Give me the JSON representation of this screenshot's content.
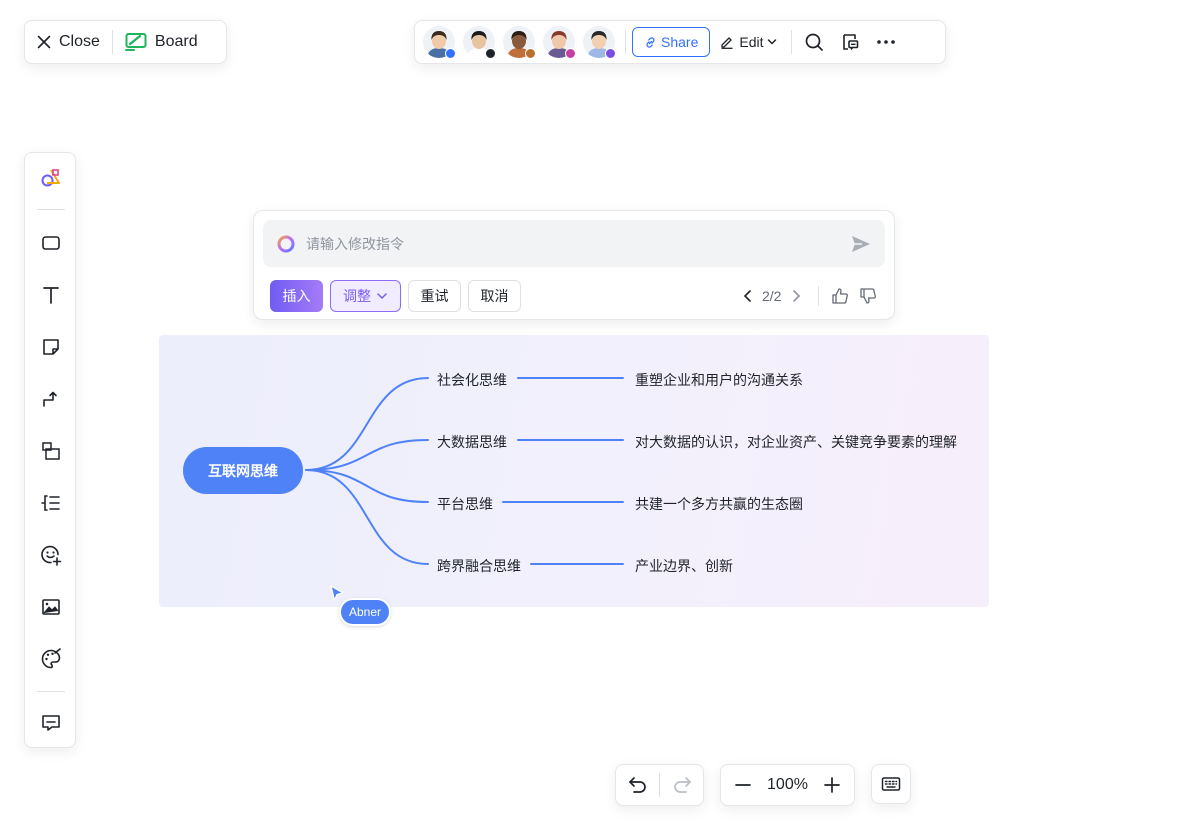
{
  "header": {
    "close_label": "Close",
    "board_label": "Board"
  },
  "collaborators": [
    {
      "name": "collaborator-1",
      "skin": "#f0c9a6",
      "hair": "#3a2a20",
      "shirt": "#4a6fa5",
      "status": "#3370ff"
    },
    {
      "name": "collaborator-2",
      "skin": "#e9c2a0",
      "hair": "#1c1c1c",
      "shirt": "#ffffff",
      "status": "#1f2329"
    },
    {
      "name": "collaborator-3",
      "skin": "#8a5a3c",
      "hair": "#2b1d14",
      "shirt": "#c0703c",
      "status": "#b7702e"
    },
    {
      "name": "collaborator-4",
      "skin": "#f1c7a9",
      "hair": "#8a3a2a",
      "shirt": "#6b5b95",
      "status": "#c43fa3"
    },
    {
      "name": "collaborator-5",
      "skin": "#f3cfb2",
      "hair": "#2a2a2a",
      "shirt": "#9fb7e6",
      "status": "#7b4ee0"
    }
  ],
  "toolbar": {
    "share_label": "Share",
    "edit_label": "Edit"
  },
  "ai_prompt": {
    "placeholder": "请输入修改指令",
    "insert_label": "插入",
    "adjust_label": "调整",
    "retry_label": "重试",
    "cancel_label": "取消",
    "pager": "2/2"
  },
  "mindmap": {
    "root": "互联网思维",
    "branches": [
      {
        "label": "社会化思维",
        "detail": "重塑企业和用户的沟通关系"
      },
      {
        "label": "大数据思维",
        "detail": "对大数据的认识，对企业资产、关键竞争要素的理解"
      },
      {
        "label": "平台思维",
        "detail": "共建一个多方共赢的生态圈"
      },
      {
        "label": "跨界融合思维",
        "detail": "产业边界、创新"
      }
    ]
  },
  "cursor": {
    "name": "Abner"
  },
  "zoom": {
    "level": "100%"
  },
  "colors": {
    "accent": "#3370ff",
    "node": "#4f82f7",
    "branch_line": "#4f82f7"
  }
}
